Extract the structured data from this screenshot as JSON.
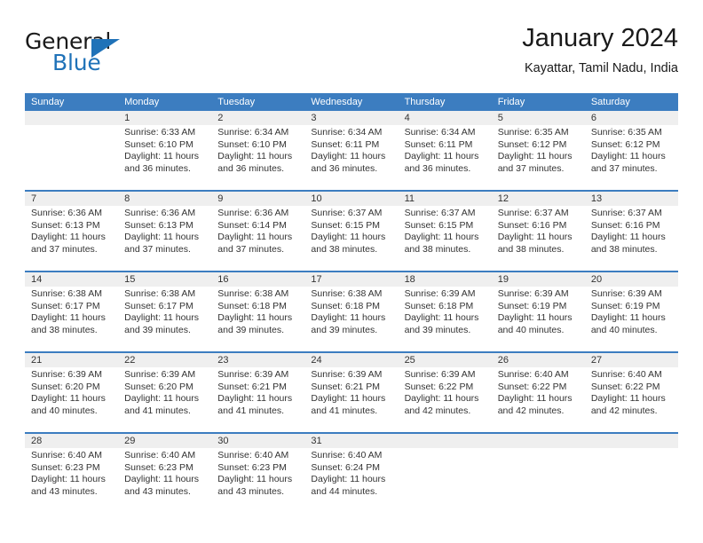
{
  "brand": {
    "word_one": "General",
    "word_two": "Blue",
    "accent_color": "#1f72b8"
  },
  "header": {
    "title": "January 2024",
    "subtitle": "Kayattar, Tamil Nadu, India"
  },
  "theme": {
    "header_bar_color": "#3c7dc0",
    "daynum_band_color": "#efefef",
    "text_color": "#333333"
  },
  "weekdays": [
    "Sunday",
    "Monday",
    "Tuesday",
    "Wednesday",
    "Thursday",
    "Friday",
    "Saturday"
  ],
  "weeks": [
    [
      {
        "day": "",
        "sunrise": "",
        "sunset": "",
        "daylight_line1": "",
        "daylight_line2": ""
      },
      {
        "day": "1",
        "sunrise": "Sunrise: 6:33 AM",
        "sunset": "Sunset: 6:10 PM",
        "daylight_line1": "Daylight: 11 hours",
        "daylight_line2": "and 36 minutes."
      },
      {
        "day": "2",
        "sunrise": "Sunrise: 6:34 AM",
        "sunset": "Sunset: 6:10 PM",
        "daylight_line1": "Daylight: 11 hours",
        "daylight_line2": "and 36 minutes."
      },
      {
        "day": "3",
        "sunrise": "Sunrise: 6:34 AM",
        "sunset": "Sunset: 6:11 PM",
        "daylight_line1": "Daylight: 11 hours",
        "daylight_line2": "and 36 minutes."
      },
      {
        "day": "4",
        "sunrise": "Sunrise: 6:34 AM",
        "sunset": "Sunset: 6:11 PM",
        "daylight_line1": "Daylight: 11 hours",
        "daylight_line2": "and 36 minutes."
      },
      {
        "day": "5",
        "sunrise": "Sunrise: 6:35 AM",
        "sunset": "Sunset: 6:12 PM",
        "daylight_line1": "Daylight: 11 hours",
        "daylight_line2": "and 37 minutes."
      },
      {
        "day": "6",
        "sunrise": "Sunrise: 6:35 AM",
        "sunset": "Sunset: 6:12 PM",
        "daylight_line1": "Daylight: 11 hours",
        "daylight_line2": "and 37 minutes."
      }
    ],
    [
      {
        "day": "7",
        "sunrise": "Sunrise: 6:36 AM",
        "sunset": "Sunset: 6:13 PM",
        "daylight_line1": "Daylight: 11 hours",
        "daylight_line2": "and 37 minutes."
      },
      {
        "day": "8",
        "sunrise": "Sunrise: 6:36 AM",
        "sunset": "Sunset: 6:13 PM",
        "daylight_line1": "Daylight: 11 hours",
        "daylight_line2": "and 37 minutes."
      },
      {
        "day": "9",
        "sunrise": "Sunrise: 6:36 AM",
        "sunset": "Sunset: 6:14 PM",
        "daylight_line1": "Daylight: 11 hours",
        "daylight_line2": "and 37 minutes."
      },
      {
        "day": "10",
        "sunrise": "Sunrise: 6:37 AM",
        "sunset": "Sunset: 6:15 PM",
        "daylight_line1": "Daylight: 11 hours",
        "daylight_line2": "and 38 minutes."
      },
      {
        "day": "11",
        "sunrise": "Sunrise: 6:37 AM",
        "sunset": "Sunset: 6:15 PM",
        "daylight_line1": "Daylight: 11 hours",
        "daylight_line2": "and 38 minutes."
      },
      {
        "day": "12",
        "sunrise": "Sunrise: 6:37 AM",
        "sunset": "Sunset: 6:16 PM",
        "daylight_line1": "Daylight: 11 hours",
        "daylight_line2": "and 38 minutes."
      },
      {
        "day": "13",
        "sunrise": "Sunrise: 6:37 AM",
        "sunset": "Sunset: 6:16 PM",
        "daylight_line1": "Daylight: 11 hours",
        "daylight_line2": "and 38 minutes."
      }
    ],
    [
      {
        "day": "14",
        "sunrise": "Sunrise: 6:38 AM",
        "sunset": "Sunset: 6:17 PM",
        "daylight_line1": "Daylight: 11 hours",
        "daylight_line2": "and 38 minutes."
      },
      {
        "day": "15",
        "sunrise": "Sunrise: 6:38 AM",
        "sunset": "Sunset: 6:17 PM",
        "daylight_line1": "Daylight: 11 hours",
        "daylight_line2": "and 39 minutes."
      },
      {
        "day": "16",
        "sunrise": "Sunrise: 6:38 AM",
        "sunset": "Sunset: 6:18 PM",
        "daylight_line1": "Daylight: 11 hours",
        "daylight_line2": "and 39 minutes."
      },
      {
        "day": "17",
        "sunrise": "Sunrise: 6:38 AM",
        "sunset": "Sunset: 6:18 PM",
        "daylight_line1": "Daylight: 11 hours",
        "daylight_line2": "and 39 minutes."
      },
      {
        "day": "18",
        "sunrise": "Sunrise: 6:39 AM",
        "sunset": "Sunset: 6:18 PM",
        "daylight_line1": "Daylight: 11 hours",
        "daylight_line2": "and 39 minutes."
      },
      {
        "day": "19",
        "sunrise": "Sunrise: 6:39 AM",
        "sunset": "Sunset: 6:19 PM",
        "daylight_line1": "Daylight: 11 hours",
        "daylight_line2": "and 40 minutes."
      },
      {
        "day": "20",
        "sunrise": "Sunrise: 6:39 AM",
        "sunset": "Sunset: 6:19 PM",
        "daylight_line1": "Daylight: 11 hours",
        "daylight_line2": "and 40 minutes."
      }
    ],
    [
      {
        "day": "21",
        "sunrise": "Sunrise: 6:39 AM",
        "sunset": "Sunset: 6:20 PM",
        "daylight_line1": "Daylight: 11 hours",
        "daylight_line2": "and 40 minutes."
      },
      {
        "day": "22",
        "sunrise": "Sunrise: 6:39 AM",
        "sunset": "Sunset: 6:20 PM",
        "daylight_line1": "Daylight: 11 hours",
        "daylight_line2": "and 41 minutes."
      },
      {
        "day": "23",
        "sunrise": "Sunrise: 6:39 AM",
        "sunset": "Sunset: 6:21 PM",
        "daylight_line1": "Daylight: 11 hours",
        "daylight_line2": "and 41 minutes."
      },
      {
        "day": "24",
        "sunrise": "Sunrise: 6:39 AM",
        "sunset": "Sunset: 6:21 PM",
        "daylight_line1": "Daylight: 11 hours",
        "daylight_line2": "and 41 minutes."
      },
      {
        "day": "25",
        "sunrise": "Sunrise: 6:39 AM",
        "sunset": "Sunset: 6:22 PM",
        "daylight_line1": "Daylight: 11 hours",
        "daylight_line2": "and 42 minutes."
      },
      {
        "day": "26",
        "sunrise": "Sunrise: 6:40 AM",
        "sunset": "Sunset: 6:22 PM",
        "daylight_line1": "Daylight: 11 hours",
        "daylight_line2": "and 42 minutes."
      },
      {
        "day": "27",
        "sunrise": "Sunrise: 6:40 AM",
        "sunset": "Sunset: 6:22 PM",
        "daylight_line1": "Daylight: 11 hours",
        "daylight_line2": "and 42 minutes."
      }
    ],
    [
      {
        "day": "28",
        "sunrise": "Sunrise: 6:40 AM",
        "sunset": "Sunset: 6:23 PM",
        "daylight_line1": "Daylight: 11 hours",
        "daylight_line2": "and 43 minutes."
      },
      {
        "day": "29",
        "sunrise": "Sunrise: 6:40 AM",
        "sunset": "Sunset: 6:23 PM",
        "daylight_line1": "Daylight: 11 hours",
        "daylight_line2": "and 43 minutes."
      },
      {
        "day": "30",
        "sunrise": "Sunrise: 6:40 AM",
        "sunset": "Sunset: 6:23 PM",
        "daylight_line1": "Daylight: 11 hours",
        "daylight_line2": "and 43 minutes."
      },
      {
        "day": "31",
        "sunrise": "Sunrise: 6:40 AM",
        "sunset": "Sunset: 6:24 PM",
        "daylight_line1": "Daylight: 11 hours",
        "daylight_line2": "and 44 minutes."
      },
      {
        "day": "",
        "sunrise": "",
        "sunset": "",
        "daylight_line1": "",
        "daylight_line2": ""
      },
      {
        "day": "",
        "sunrise": "",
        "sunset": "",
        "daylight_line1": "",
        "daylight_line2": ""
      },
      {
        "day": "",
        "sunrise": "",
        "sunset": "",
        "daylight_line1": "",
        "daylight_line2": ""
      }
    ]
  ]
}
